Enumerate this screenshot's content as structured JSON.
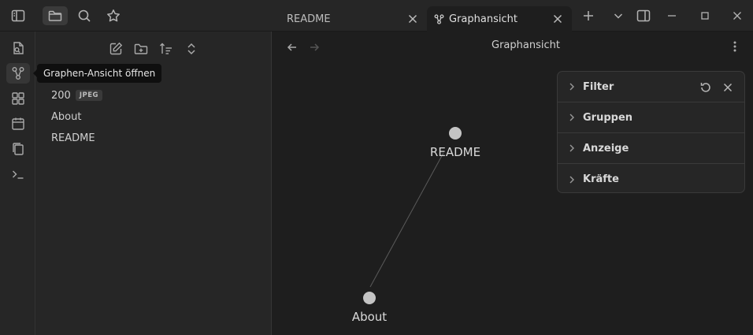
{
  "tabs": [
    {
      "title": "README",
      "active": false
    },
    {
      "title": "Graphansicht",
      "active": true
    }
  ],
  "tooltip": "Graphen-Ansicht öffnen",
  "files": [
    {
      "name": "200",
      "badge": "JPEG"
    },
    {
      "name": "About"
    },
    {
      "name": "README"
    }
  ],
  "view": {
    "title": "Graphansicht"
  },
  "graph": {
    "nodes": [
      {
        "id": "README",
        "label": "README"
      },
      {
        "id": "About",
        "label": "About"
      }
    ],
    "edges": [
      [
        "README",
        "About"
      ]
    ]
  },
  "filter_panel": {
    "sections": [
      "Filter",
      "Gruppen",
      "Anzeige",
      "Kräfte"
    ]
  },
  "icons": {
    "titlebar": [
      "sidebar-toggle-icon",
      "folder-icon",
      "search-icon",
      "star-icon"
    ],
    "ribbon": [
      "open-switcher-icon",
      "graph-icon",
      "canvas-icon",
      "calendar-icon",
      "templates-icon",
      "terminal-icon"
    ],
    "sidebar_tools": [
      "new-note-icon",
      "new-folder-icon",
      "sort-icon",
      "collapse-icon"
    ]
  },
  "colors": {
    "background": "#1e1e1e",
    "sidebar": "#262626",
    "node": "#c4c4c4"
  }
}
